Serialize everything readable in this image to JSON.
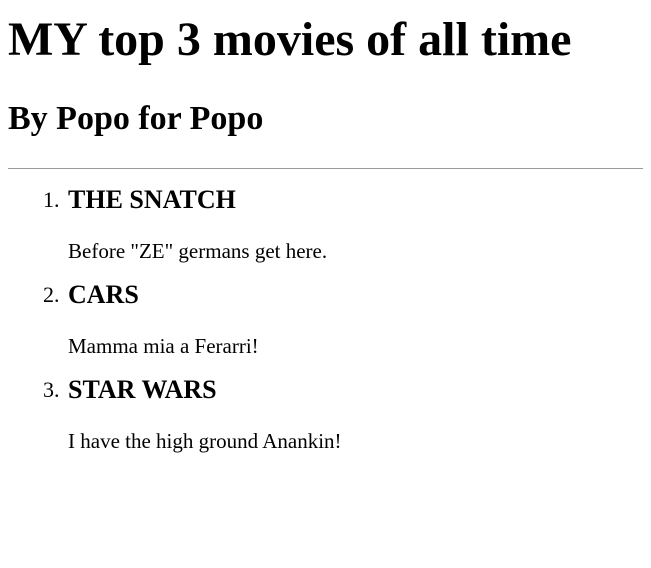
{
  "page": {
    "title": "MY top 3 movies of all time",
    "subtitle": "By Popo for Popo"
  },
  "movies": [
    {
      "number": "1.",
      "title": "THE SNATCH",
      "description": "Before \"ZE\" germans get here."
    },
    {
      "number": "2.",
      "title": "CARS",
      "description": "Mamma mia a Ferarri!"
    },
    {
      "number": "3.",
      "title": "STAR WARS",
      "description": "I have the high ground Anankin!"
    }
  ]
}
